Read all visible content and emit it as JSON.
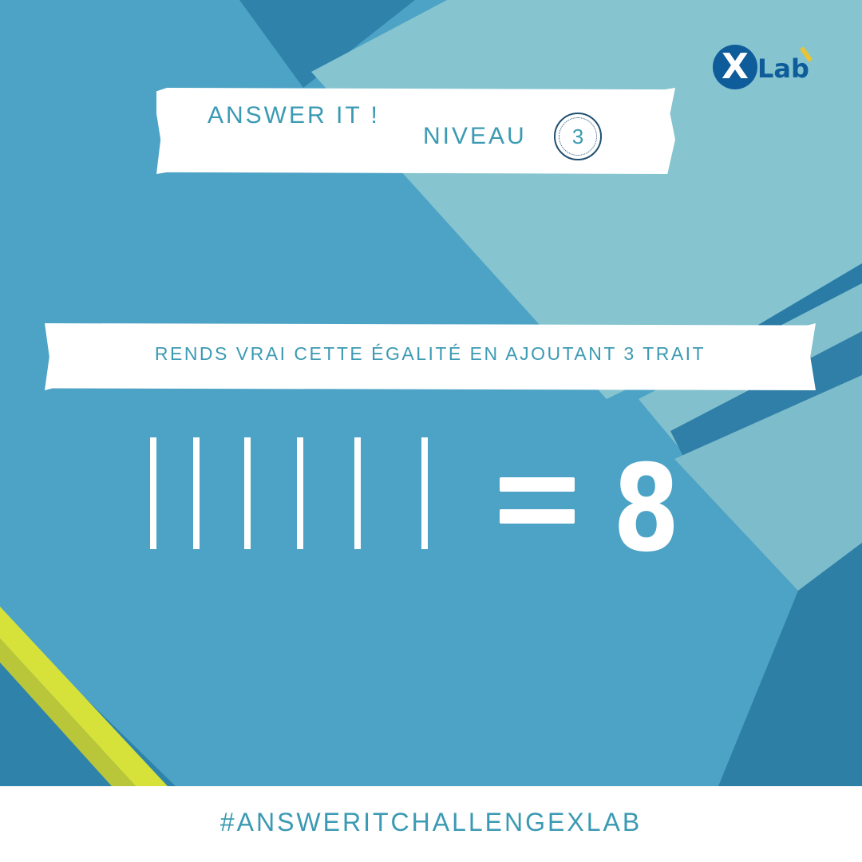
{
  "brand": {
    "logo_mark": "X",
    "logo_text": "Lab"
  },
  "header": {
    "title": "ANSWER IT !",
    "level_label": "NIVEAU",
    "level_number": "3"
  },
  "instruction": "RENDS VRAI CETTE ÉGALITÉ EN AJOUTANT 3 TRAIT",
  "equation": {
    "stick_count": 6,
    "operator": "=",
    "result": "8"
  },
  "footer": {
    "hashtag": "#ANSWERITCHALLENGEXLAB"
  },
  "colors": {
    "text_accent": "#3b9ab3",
    "background_main": "#4da3c6",
    "background_light": "#86c4d0",
    "background_dark": "#2e7fa6",
    "stripe_yellow": "#d6e23a",
    "logo_blue": "#0e5c9a"
  }
}
